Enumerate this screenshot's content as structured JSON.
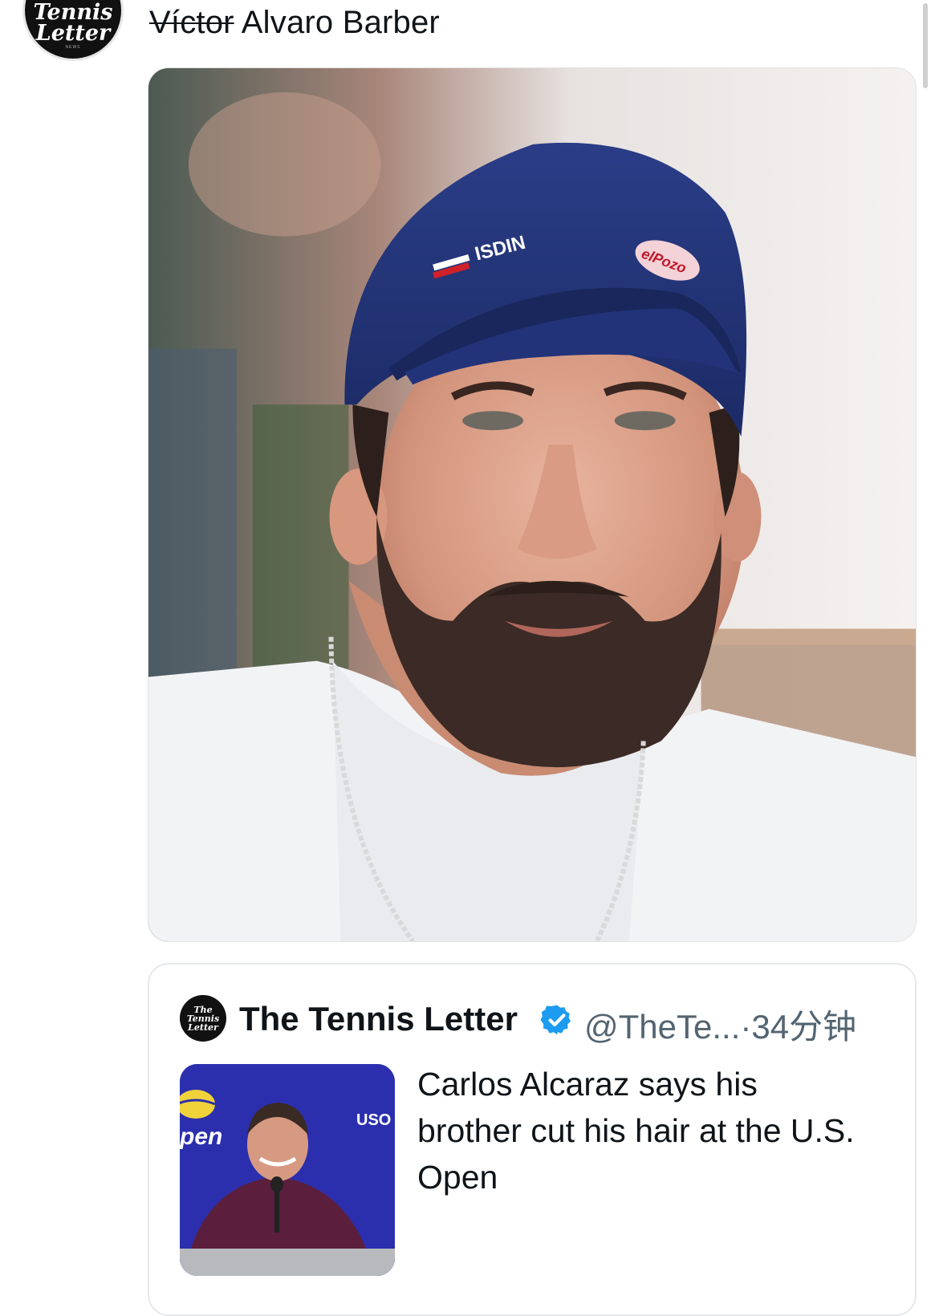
{
  "post": {
    "author_avatar_text": "Tennis Letter",
    "text_strikethrough": "Víctor",
    "text_rest": "Alvaro Barber"
  },
  "photo": {
    "cap_logo_left": "ISDIN",
    "cap_logo_right": "elPozo"
  },
  "quote": {
    "avatar_text": [
      "The",
      "Tennis",
      "Letter"
    ],
    "display_name": "The Tennis Letter",
    "verified": true,
    "handle": "@TheTe...",
    "separator": "·",
    "time": "34分钟",
    "title": "Carlos Alcaraz says his brother cut his hair at the U.S. Open",
    "thumb_banner_left": "pen",
    "thumb_banner_right": "USO"
  },
  "colors": {
    "verified": "#1d9bf0",
    "handle": "#536471",
    "thumb_bg": "#2b2fae"
  }
}
